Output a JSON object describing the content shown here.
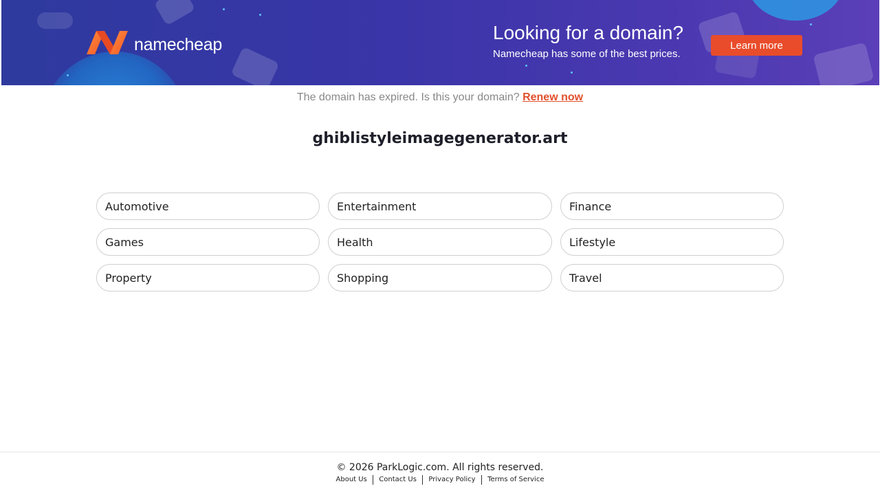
{
  "banner": {
    "brand": "namecheap",
    "promo_title": "Looking for a domain?",
    "promo_subtitle": "Namecheap has some of the best prices.",
    "learn_more": "Learn more",
    "colors": {
      "accent": "#e94c2b",
      "background": "#3a35a8",
      "logo_orange": "#f26522"
    }
  },
  "notice": {
    "text": "The domain has expired. Is this your domain?",
    "renew": "Renew now"
  },
  "domain": "ghiblistyleimagegenerator.art",
  "categories": [
    "Automotive",
    "Entertainment",
    "Finance",
    "Games",
    "Health",
    "Lifestyle",
    "Property",
    "Shopping",
    "Travel"
  ],
  "footer": {
    "copyright": "© 2026 ParkLogic.com. All rights reserved.",
    "links": [
      "About Us",
      "Contact Us",
      "Privacy Policy",
      "Terms of Service"
    ]
  }
}
